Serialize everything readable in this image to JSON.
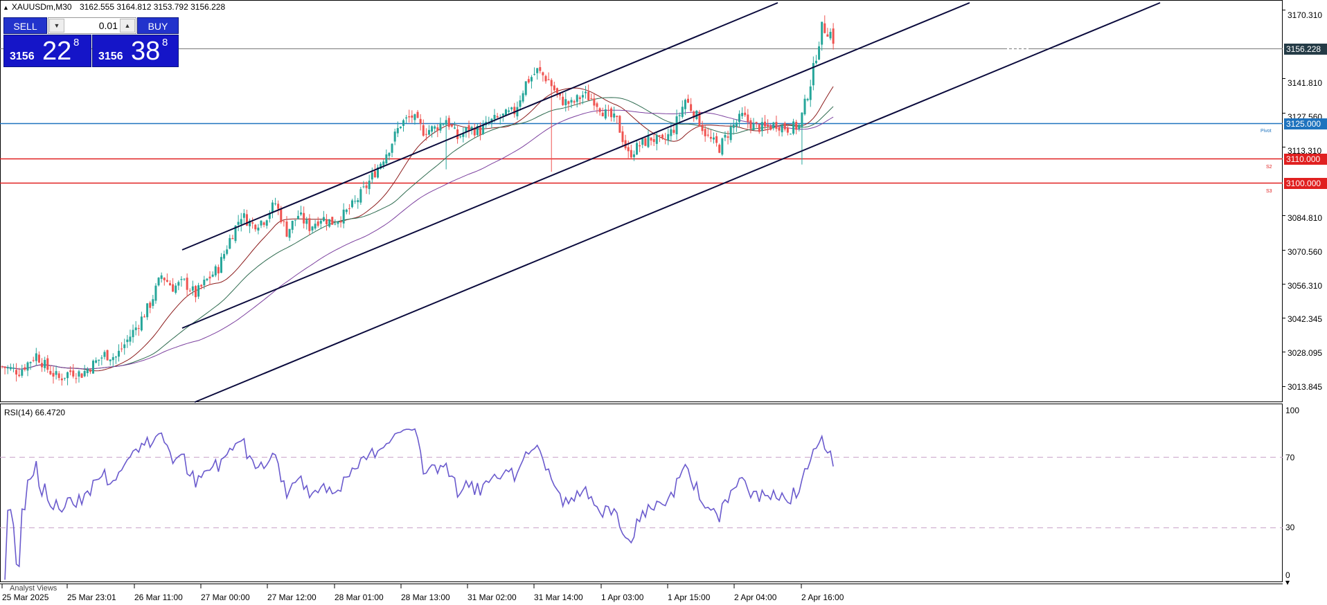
{
  "header": {
    "symbol": "XAUUSDm,M30",
    "ohlc": "3162.555 3164.812 3153.792 3156.228"
  },
  "trade_panel": {
    "sell_label": "SELL",
    "buy_label": "BUY",
    "volume": "0.01",
    "sell_price_small": "3156",
    "sell_price_big": "22",
    "sell_price_sup": "8",
    "buy_price_small": "3156",
    "buy_price_big": "38",
    "buy_price_sup": "8"
  },
  "price_axis": {
    "ticks": [
      "3170.310",
      "3141.810",
      "3127.560",
      "3113.310",
      "3084.810",
      "3070.560",
      "3056.310",
      "3042.345",
      "3028.095",
      "3013.845"
    ]
  },
  "price_tags": {
    "current": "3156.228",
    "pivot": "3125.000",
    "s2": "3110.000",
    "s3": "3100.000"
  },
  "level_labels": {
    "pivot": "Pivot",
    "s2": "S2",
    "s3": "S3"
  },
  "rsi": {
    "label": "RSI(14) 66.4720",
    "ticks": [
      "100",
      "70",
      "30",
      "0"
    ]
  },
  "time_axis": {
    "labels": [
      "25 Mar 2025",
      "25 Mar 23:01",
      "26 Mar 11:00",
      "27 Mar 00:00",
      "27 Mar 12:00",
      "28 Mar 01:00",
      "28 Mar 13:00",
      "31 Mar 02:00",
      "31 Mar 14:00",
      "1 Apr 03:00",
      "1 Apr 15:00",
      "2 Apr 04:00",
      "2 Apr 16:00"
    ]
  },
  "footer": {
    "analyst_views": "Analyst Views"
  },
  "colors": {
    "bull": "#26a69a",
    "bear": "#ef5350",
    "pivot": "#1e73be",
    "support": "#e02020",
    "channel": "#0a0a3c",
    "rsi": "#6a5acd",
    "ma_fast": "#8b1a1a",
    "ma_mid": "#2e6b4f",
    "ma_slow": "#7b3f9e"
  },
  "chart_data": {
    "type": "candlestick",
    "symbol": "XAUUSDm",
    "timeframe": "M30",
    "ylim": [
      3007.5,
      3174.4
    ],
    "close_path": [
      [
        0,
        3022
      ],
      [
        6,
        3020
      ],
      [
        12,
        3027
      ],
      [
        16,
        3021
      ],
      [
        20,
        3017
      ],
      [
        24,
        3020
      ],
      [
        28,
        3019
      ],
      [
        32,
        3023
      ],
      [
        36,
        3027
      ],
      [
        40,
        3026
      ],
      [
        44,
        3033
      ],
      [
        48,
        3040
      ],
      [
        52,
        3048
      ],
      [
        56,
        3060
      ],
      [
        60,
        3055
      ],
      [
        64,
        3057
      ],
      [
        68,
        3052
      ],
      [
        72,
        3058
      ],
      [
        76,
        3063
      ],
      [
        80,
        3075
      ],
      [
        84,
        3085
      ],
      [
        88,
        3081
      ],
      [
        92,
        3083
      ],
      [
        96,
        3090
      ],
      [
        100,
        3078
      ],
      [
        104,
        3085
      ],
      [
        108,
        3080
      ],
      [
        112,
        3084
      ],
      [
        116,
        3082
      ],
      [
        120,
        3085
      ],
      [
        124,
        3090
      ],
      [
        128,
        3097
      ],
      [
        132,
        3105
      ],
      [
        136,
        3113
      ],
      [
        140,
        3123
      ],
      [
        144,
        3126
      ],
      [
        148,
        3120
      ],
      [
        152,
        3121
      ],
      [
        156,
        3125
      ],
      [
        160,
        3117
      ],
      [
        164,
        3121
      ],
      [
        168,
        3120
      ],
      [
        172,
        3124
      ],
      [
        176,
        3126
      ],
      [
        180,
        3128
      ],
      [
        184,
        3140
      ],
      [
        188,
        3145
      ],
      [
        192,
        3141
      ],
      [
        196,
        3133
      ],
      [
        200,
        3131
      ],
      [
        204,
        3135
      ],
      [
        208,
        3133
      ],
      [
        212,
        3127
      ],
      [
        216,
        3124
      ],
      [
        220,
        3110
      ],
      [
        224,
        3114
      ],
      [
        228,
        3117
      ],
      [
        232,
        3115
      ],
      [
        236,
        3121
      ],
      [
        240,
        3133
      ],
      [
        244,
        3126
      ],
      [
        248,
        3117
      ],
      [
        252,
        3113
      ],
      [
        256,
        3121
      ],
      [
        260,
        3126
      ],
      [
        264,
        3122
      ],
      [
        268,
        3121
      ],
      [
        272,
        3123
      ],
      [
        276,
        3121
      ],
      [
        280,
        3122
      ],
      [
        284,
        3140
      ],
      [
        288,
        3163
      ],
      [
        292,
        3160
      ]
    ],
    "moving_averages": 3,
    "rsi_period": 14,
    "rsi_current": 66.472,
    "rsi_levels": [
      70,
      30
    ],
    "horizontal_levels": [
      {
        "name": "Pivot",
        "value": 3125.0
      },
      {
        "name": "S2",
        "value": 3110.0
      },
      {
        "name": "S3",
        "value": 3100.0
      },
      {
        "name": "Bid",
        "value": 3156.228
      }
    ]
  }
}
